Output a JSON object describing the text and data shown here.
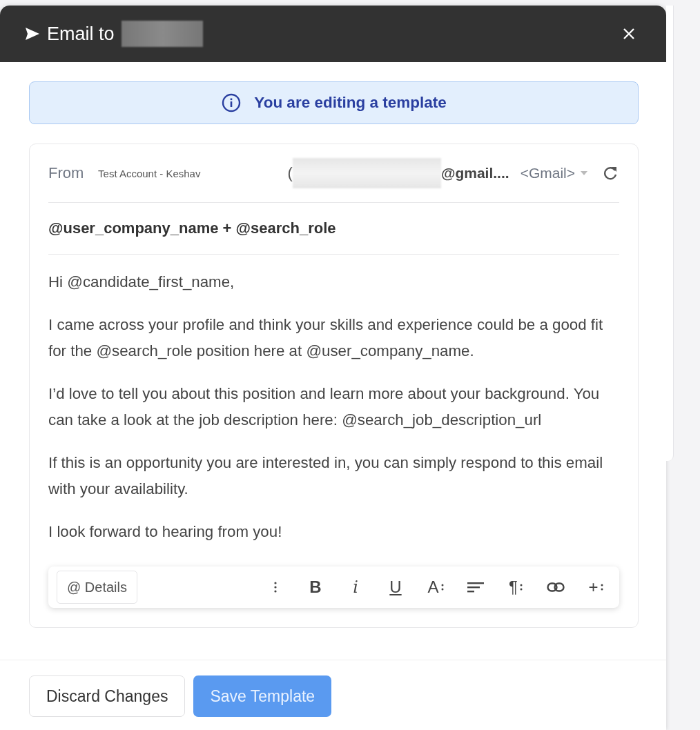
{
  "dialog": {
    "title": "Email to",
    "recipient_redacted": true
  },
  "notice": {
    "text": "You are editing a template"
  },
  "from": {
    "label": "From",
    "sender": "Test Account - Keshav",
    "paren": "(",
    "address_redacted": true,
    "address": "@gmail....",
    "provider": "<Gmail>"
  },
  "subject": "@user_company_name + @search_role",
  "body": [
    "Hi @candidate_first_name,",
    "I came across your profile and think your skills and experience could be a good fit for the @search_role position here at @user_company_name.",
    "I’d love to tell you about this position and learn more about your background. You can take a look at the job description here: @search_job_description_url",
    "If this is an opportunity you are interested in, you can simply respond to this email with your availability.",
    "I look forward to hearing from you!"
  ],
  "toolbar": {
    "details": "@ Details",
    "tools": [
      {
        "kind": "more"
      },
      {
        "kind": "bold",
        "label": "B"
      },
      {
        "kind": "italic",
        "label": "i"
      },
      {
        "kind": "underline",
        "label": "U"
      },
      {
        "kind": "font",
        "label": "A"
      },
      {
        "kind": "align"
      },
      {
        "kind": "paragraph",
        "label": "¶"
      },
      {
        "kind": "link"
      },
      {
        "kind": "insert",
        "label": "+"
      }
    ]
  },
  "buttons": [
    {
      "kind": "secondary",
      "label": "Discard Changes"
    },
    {
      "kind": "primary",
      "label": "Save Template"
    }
  ]
}
